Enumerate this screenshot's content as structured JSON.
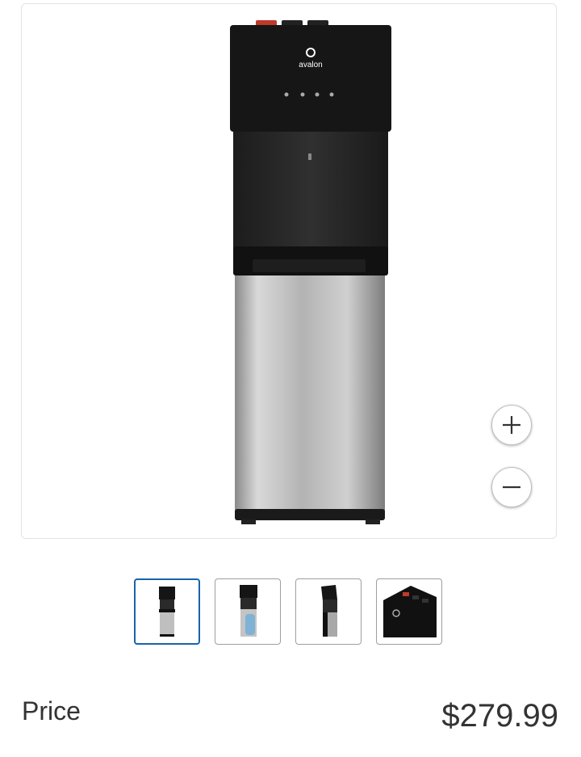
{
  "product": {
    "image_alt": "Water dispenser",
    "brand_logo_text": "avalon"
  },
  "zoom": {
    "in_icon": "plus-icon",
    "out_icon": "minus-icon"
  },
  "thumbnails": [
    {
      "name": "front-view",
      "selected": true
    },
    {
      "name": "bottle-view",
      "selected": false
    },
    {
      "name": "angle-view",
      "selected": false
    },
    {
      "name": "controls-closeup",
      "selected": false
    }
  ],
  "price": {
    "label": "Price",
    "value": "$279.99"
  },
  "colors": {
    "selected_border": "#1863aa"
  }
}
